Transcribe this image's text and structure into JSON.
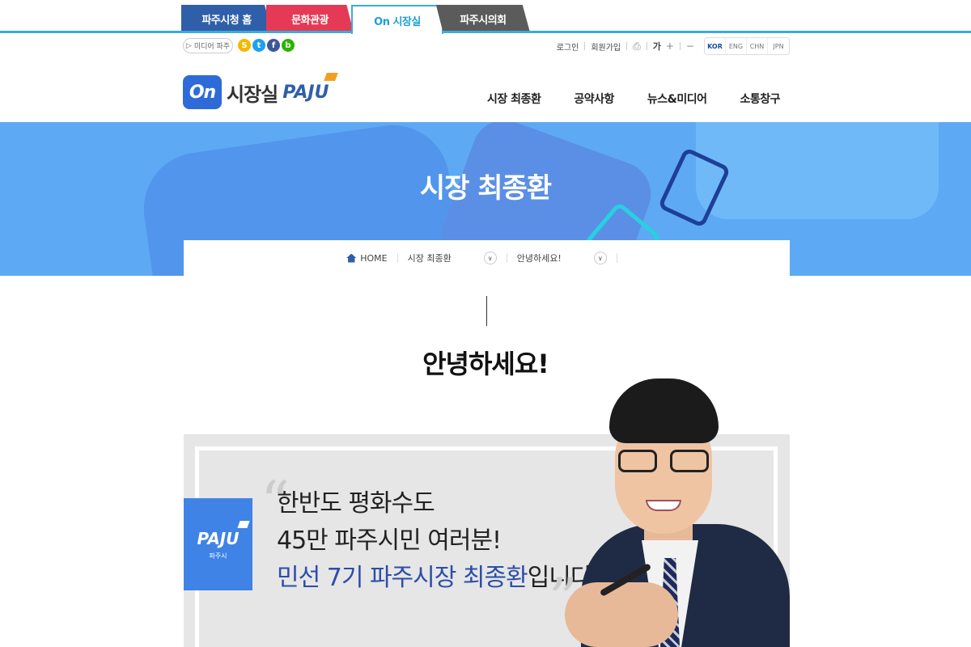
{
  "top_tabs": [
    "파주시청 홈",
    "문화관광",
    "On 시장실",
    "파주시의회"
  ],
  "util": {
    "media_label": "미디어 파주",
    "sns": [
      {
        "icon": "kakao-story-icon",
        "glyph": "S",
        "color": "#f5b800"
      },
      {
        "icon": "twitter-icon",
        "glyph": "t",
        "color": "#1da1f2"
      },
      {
        "icon": "facebook-icon",
        "glyph": "f",
        "color": "#3b5998"
      },
      {
        "icon": "blog-icon",
        "glyph": "b",
        "color": "#2db400"
      }
    ],
    "login": "로그인",
    "join": "회원가입",
    "font_label": "가",
    "plus": "+",
    "minus": "−",
    "langs": [
      "KOR",
      "ENG",
      "CHN",
      "JPN"
    ]
  },
  "logo": {
    "on": "On",
    "name": "시장실",
    "paju": "PAJU"
  },
  "gnb": [
    "시장 최종환",
    "공약사항",
    "뉴스&미디어",
    "소통창구"
  ],
  "visual": {
    "title": "시장 최종환"
  },
  "breadcrumb": {
    "home": "HOME",
    "level1": "시장 최종환",
    "level2": "안녕하세요!",
    "dropdown_icon": "chevron-down-icon"
  },
  "content": {
    "heading": "안녕하세요!",
    "badge": {
      "paju": "PAJU",
      "sub": "파주시"
    },
    "message": {
      "line1": "한반도 평화수도",
      "line2": "45만 파주시민 여러분!",
      "line3_em": "민선 7기 파주시장 최종환",
      "line3_rest": "입니다."
    }
  },
  "colors": {
    "brand_blue": "#2f5fa8",
    "accent_cyan": "#3ea9d9",
    "banner": "#5ea9f3",
    "culture_red": "#e43a55"
  }
}
